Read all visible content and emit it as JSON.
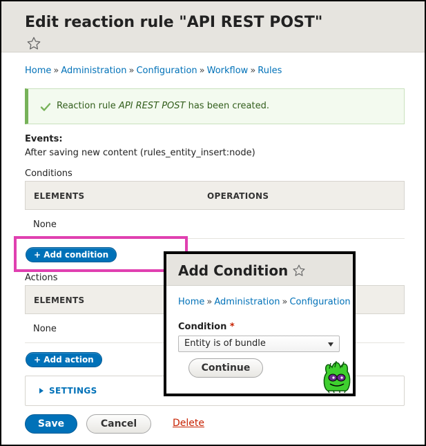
{
  "page": {
    "title": "Edit reaction rule \"API REST POST\"",
    "star_icon": "star-outline-icon"
  },
  "breadcrumb": {
    "items": [
      "Home",
      "Administration",
      "Configuration",
      "Workflow",
      "Rules"
    ],
    "separator": "»"
  },
  "message": {
    "icon": "check-icon",
    "prefix": "Reaction rule ",
    "name": "API REST POST",
    "suffix": " has been created."
  },
  "events": {
    "label": "Events:",
    "value": "After saving new content (rules_entity_insert:node)"
  },
  "conditions": {
    "label": "Conditions",
    "columns": [
      "ELEMENTS",
      "OPERATIONS"
    ],
    "rows": [
      "None"
    ],
    "add_button": "+ Add condition"
  },
  "actions": {
    "label": "Actions",
    "columns": [
      "ELEMENTS"
    ],
    "rows": [
      "None"
    ],
    "add_button": "+ Add action"
  },
  "settings": {
    "label": "SETTINGS"
  },
  "form_actions": {
    "save": "Save",
    "cancel": "Cancel",
    "delete": "Delete"
  },
  "modal": {
    "title": "Add Condition",
    "breadcrumb": [
      "Home",
      "Administration",
      "Configuration"
    ],
    "field_label": "Condition",
    "required_mark": "*",
    "selected_option": "Entity is of bundle",
    "continue": "Continue",
    "mascot_icon": "druplicon-mascot-icon"
  },
  "colors": {
    "link": "#0071b8",
    "primary_button": "#0071b8",
    "success_border": "#77b259",
    "highlight": "#e040b0",
    "danger": "#c72100"
  }
}
